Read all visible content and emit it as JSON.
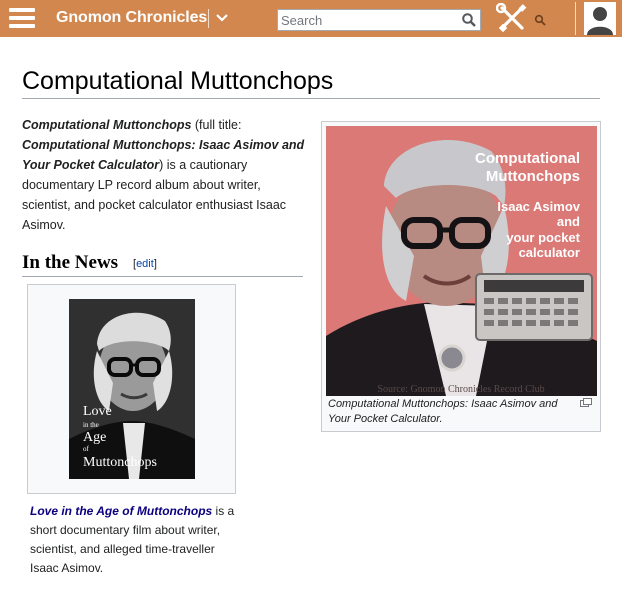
{
  "header": {
    "site_title": "Gnomon Chronicles",
    "search_placeholder": "Search",
    "search_icon": "magnifier-icon",
    "menu_icon": "hamburger-icon",
    "tools_icon": "wrench-screwdriver-icon",
    "user_icon": "user-avatar-icon",
    "bar_color": "#d2874e"
  },
  "page": {
    "title": "Computational Muttonchops",
    "intro": {
      "bold_title": "Computational Muttonchops",
      "part1": " (full title: ",
      "bold_full_title": "Computational Muttonchops: Isaac Asimov and Your Pocket Calculator",
      "part2": ") is a cautionary documentary LP record album about writer, scientist, and pocket calculator enthusiast Isaac Asimov."
    }
  },
  "infobox": {
    "image_title_line1": "Computational",
    "image_title_line2": "Muttonchops",
    "image_subtitle_line1": "Isaac Asimov",
    "image_subtitle_line2": "and",
    "image_subtitle_line3": "your pocket",
    "image_subtitle_line4": "calculator",
    "image_source": "Source: Gnomon Chronicles Record Club",
    "caption": "Computational Muttonchops: Isaac Asimov and Your Pocket Calculator.",
    "image_bg_color": "#d8706e",
    "image_title_color": "#ffffff"
  },
  "news": {
    "heading": "In the News",
    "edit_open": "[",
    "edit_label": "edit",
    "edit_close": "]",
    "thumb_text_line1": "Love",
    "thumb_text_line2": "in the",
    "thumb_text_line3": "Age",
    "thumb_text_line4": "of",
    "thumb_text_line5": "Muttonchops",
    "link_text": "Love in the Age of Muttonchops",
    "description": " is a short documentary film about writer, scientist, and alleged time-traveller Isaac Asimov."
  }
}
